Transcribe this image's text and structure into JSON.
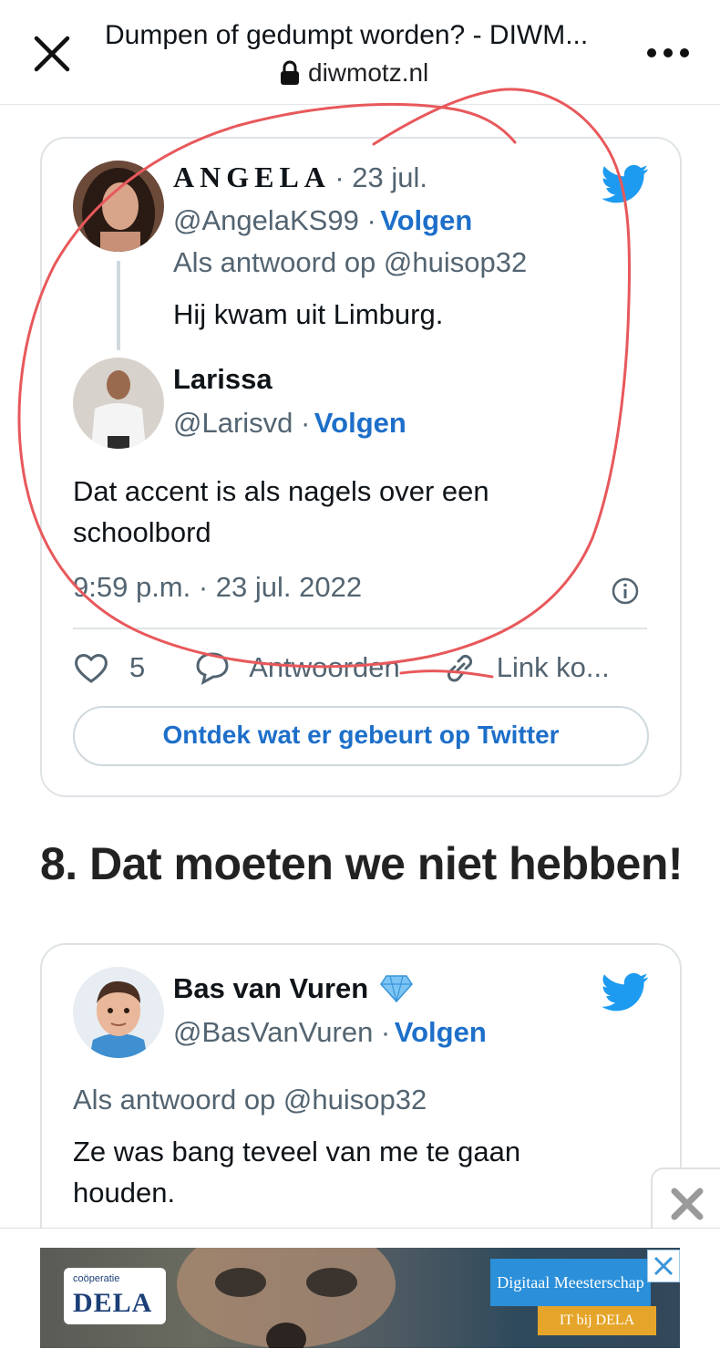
{
  "browser": {
    "title": "Dumpen of gedumpt worden? - DIWM...",
    "url": "diwmotz.nl"
  },
  "tweet1": {
    "reply_tweet": {
      "author_name": "ANGELA",
      "date": "· 23 jul.",
      "handle": "@AngelaKS99 ·",
      "follow": "Volgen",
      "reply_to": "Als antwoord op @huisop32",
      "text": "Hij kwam uit Limburg."
    },
    "main_tweet": {
      "author_name": "Larissa",
      "handle": "@Larisvd ·",
      "follow": "Volgen",
      "text_line1": "Dat accent is als nagels over een",
      "text_line2": "schoolbord",
      "timestamp": "9:59 p.m. · 23 jul. 2022"
    },
    "actions": {
      "likes": "5",
      "reply": "Antwoorden",
      "copy_link": "Link ko..."
    },
    "cta": "Ontdek wat er gebeurt op Twitter"
  },
  "section": {
    "heading": "8. Dat moeten we niet hebben!"
  },
  "tweet2": {
    "author_name": "Bas van Vuren",
    "handle": "@BasVanVuren ·",
    "follow": "Volgen",
    "reply_to": "Als antwoord op @huisop32",
    "text_line1": "Ze was bang teveel van me te gaan",
    "text_line2": "houden."
  },
  "ad": {
    "logo_small": "coöperatie",
    "logo_big": "DELA",
    "badge": "Digitaal Meesterschap",
    "badge2": "IT bij DELA"
  },
  "colors": {
    "twitter_blue": "#1d9bf0",
    "follow_blue": "#1d6fc9",
    "annotation_red": "#e8585b"
  }
}
